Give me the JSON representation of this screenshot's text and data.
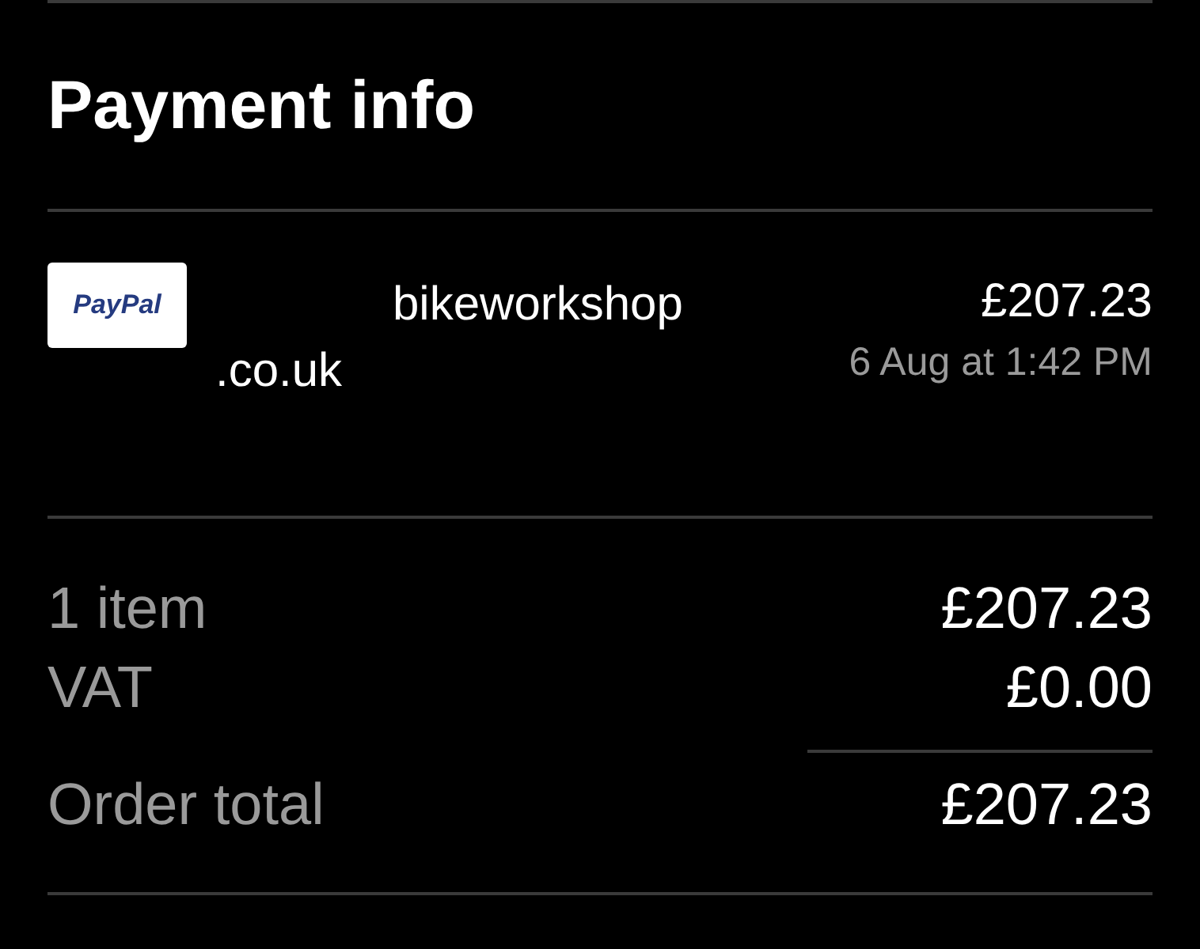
{
  "title": "Payment info",
  "payment": {
    "method_logo": "PayPal",
    "payee_lines": [
      "bikeworkshop",
      ".co.uk"
    ],
    "amount": "£207.23",
    "date": "6 Aug at 1:42 PM"
  },
  "summary": [
    {
      "label": "1 item",
      "value": "£207.23"
    },
    {
      "label": "VAT",
      "value": "£0.00"
    }
  ],
  "total": {
    "label": "Order total",
    "value": "£207.23"
  }
}
